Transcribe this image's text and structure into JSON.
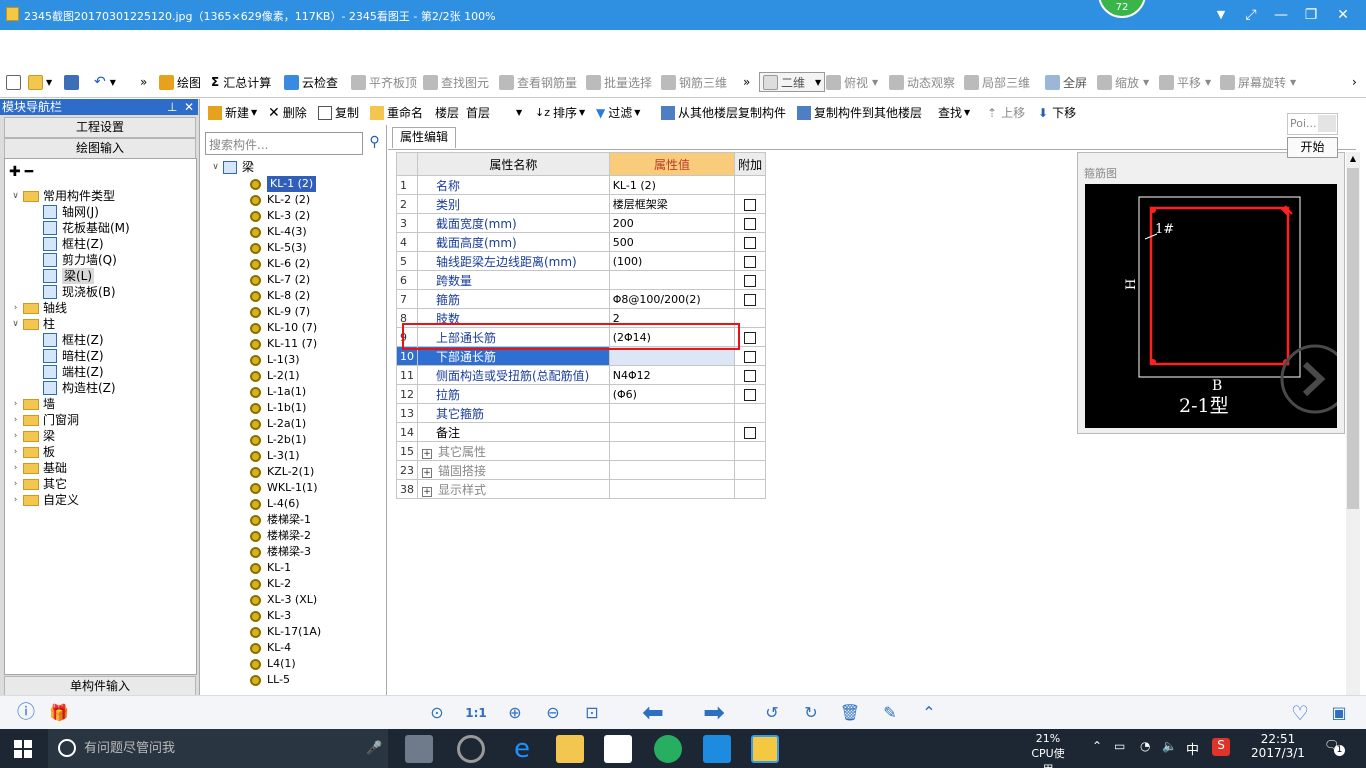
{
  "viewer": {
    "title": "2345截图20170301225120.jpg（1365×629像素，117KB）- 2345看图王 - 第2/2张 100%",
    "badge": "72"
  },
  "toolbar": {
    "draw": "绘图",
    "sigma": "Σ",
    "sum": "汇总计算",
    "cloud_check": "云检查",
    "flat_top": "平齐板顶",
    "find_element": "查找图元",
    "view_rebar": "查看钢筋量",
    "batch_select": "批量选择",
    "rebar_3d": "钢筋三维",
    "view_mode": "二维",
    "top_view": "俯视",
    "dynamic_view": "动态观察",
    "local_3d": "局部三维",
    "fullscreen": "全屏",
    "zoom": "缩放",
    "pan": "平移",
    "rotate": "屏幕旋转"
  },
  "toolbar2": {
    "new": "新建",
    "delete": "删除",
    "copy": "复制",
    "rename": "重命名",
    "floor_label": "楼层",
    "floor_value": "首层",
    "sort": "排序",
    "filter": "过滤",
    "copy_from": "从其他楼层复制构件",
    "copy_to": "复制构件到其他楼层",
    "find": "查找",
    "move_up": "上移",
    "move_down": "下移"
  },
  "nav": {
    "header": "模块导航栏",
    "project_settings": "工程设置",
    "drawing_input": "绘图输入",
    "single_input": "单构件输入",
    "tree": [
      {
        "label": "常用构件类型",
        "level": 0,
        "type": "folder",
        "expanded": true
      },
      {
        "label": "轴网(J)",
        "level": 1,
        "type": "item"
      },
      {
        "label": "花板基础(M)",
        "level": 1,
        "type": "item"
      },
      {
        "label": "框柱(Z)",
        "level": 1,
        "type": "item"
      },
      {
        "label": "剪力墙(Q)",
        "level": 1,
        "type": "item"
      },
      {
        "label": "梁(L)",
        "level": 1,
        "type": "item",
        "selected": true
      },
      {
        "label": "现浇板(B)",
        "level": 1,
        "type": "item"
      },
      {
        "label": "轴线",
        "level": 0,
        "type": "folder"
      },
      {
        "label": "柱",
        "level": 0,
        "type": "folder",
        "expanded": true
      },
      {
        "label": "框柱(Z)",
        "level": 1,
        "type": "item"
      },
      {
        "label": "暗柱(Z)",
        "level": 1,
        "type": "item"
      },
      {
        "label": "端柱(Z)",
        "level": 1,
        "type": "item"
      },
      {
        "label": "构造柱(Z)",
        "level": 1,
        "type": "item"
      },
      {
        "label": "墙",
        "level": 0,
        "type": "folder"
      },
      {
        "label": "门窗洞",
        "level": 0,
        "type": "folder"
      },
      {
        "label": "梁",
        "level": 0,
        "type": "folder"
      },
      {
        "label": "板",
        "level": 0,
        "type": "folder"
      },
      {
        "label": "基础",
        "level": 0,
        "type": "folder"
      },
      {
        "label": "其它",
        "level": 0,
        "type": "folder"
      },
      {
        "label": "自定义",
        "level": 0,
        "type": "folder"
      }
    ]
  },
  "components": {
    "search_placeholder": "搜索构件...",
    "root": "梁",
    "items": [
      "KL-1 (2)",
      "KL-2 (2)",
      "KL-3 (2)",
      "KL-4(3)",
      "KL-5(3)",
      "KL-6 (2)",
      "KL-7 (2)",
      "KL-8 (2)",
      "KL-9 (7)",
      "KL-10 (7)",
      "KL-11 (7)",
      "L-1(3)",
      "L-2(1)",
      "L-1a(1)",
      "L-1b(1)",
      "L-2a(1)",
      "L-2b(1)",
      "L-3(1)",
      "KZL-2(1)",
      "WKL-1(1)",
      "L-4(6)",
      "楼梯梁-1",
      "楼梯梁-2",
      "楼梯梁-3",
      "KL-1",
      "KL-2",
      "XL-3 (XL)",
      "KL-3",
      "KL-17(1A)",
      "KL-4",
      "L4(1)",
      "LL-5"
    ]
  },
  "props": {
    "tab": "属性编辑",
    "headers": {
      "name": "属性名称",
      "value": "属性值",
      "extra": "附加"
    },
    "rows": [
      {
        "num": "1",
        "name": "名称",
        "value": "KL-1 (2)",
        "check": false
      },
      {
        "num": "2",
        "name": "类别",
        "value": "楼层框架梁",
        "check": true
      },
      {
        "num": "3",
        "name": "截面宽度(mm)",
        "value": "200",
        "check": true
      },
      {
        "num": "4",
        "name": "截面高度(mm)",
        "value": "500",
        "check": true
      },
      {
        "num": "5",
        "name": "轴线距梁左边线距离(mm)",
        "value": "(100)",
        "check": true
      },
      {
        "num": "6",
        "name": "跨数量",
        "value": "",
        "check": true
      },
      {
        "num": "7",
        "name": "箍筋",
        "value": "Φ8@100/200(2)",
        "check": true
      },
      {
        "num": "8",
        "name": "肢数",
        "value": "2",
        "check": false
      },
      {
        "num": "9",
        "name": "上部通长筋",
        "value": "(2Φ14)",
        "check": true
      },
      {
        "num": "10",
        "name": "下部通长筋",
        "value": "",
        "check": true
      },
      {
        "num": "11",
        "name": "侧面构造或受扭筋(总配筋值)",
        "value": "N4Φ12",
        "check": true
      },
      {
        "num": "12",
        "name": "拉筋",
        "value": "(Φ6)",
        "check": true
      },
      {
        "num": "13",
        "name": "其它箍筋",
        "value": "",
        "check": false
      },
      {
        "num": "14",
        "name": "备注",
        "value": "",
        "check": true
      },
      {
        "num": "15",
        "name": "其它属性",
        "value": "",
        "check": false,
        "group": true
      },
      {
        "num": "23",
        "name": "锚固搭接",
        "value": "",
        "check": false,
        "group": true
      },
      {
        "num": "38",
        "name": "显示样式",
        "value": "",
        "check": false,
        "group": true
      }
    ]
  },
  "figure": {
    "label": "箍筋图",
    "h": "H",
    "b": "B",
    "type": "2-1型",
    "tag": "1#"
  },
  "popup": {
    "poi": "Poi...",
    "start": "开始"
  },
  "taskbar": {
    "search": "有问题尽管问我",
    "cpu_pct": "21%",
    "cpu_label": "CPU使用",
    "lang": "中",
    "time": "22:51",
    "date": "2017/3/1",
    "notif": "1"
  }
}
